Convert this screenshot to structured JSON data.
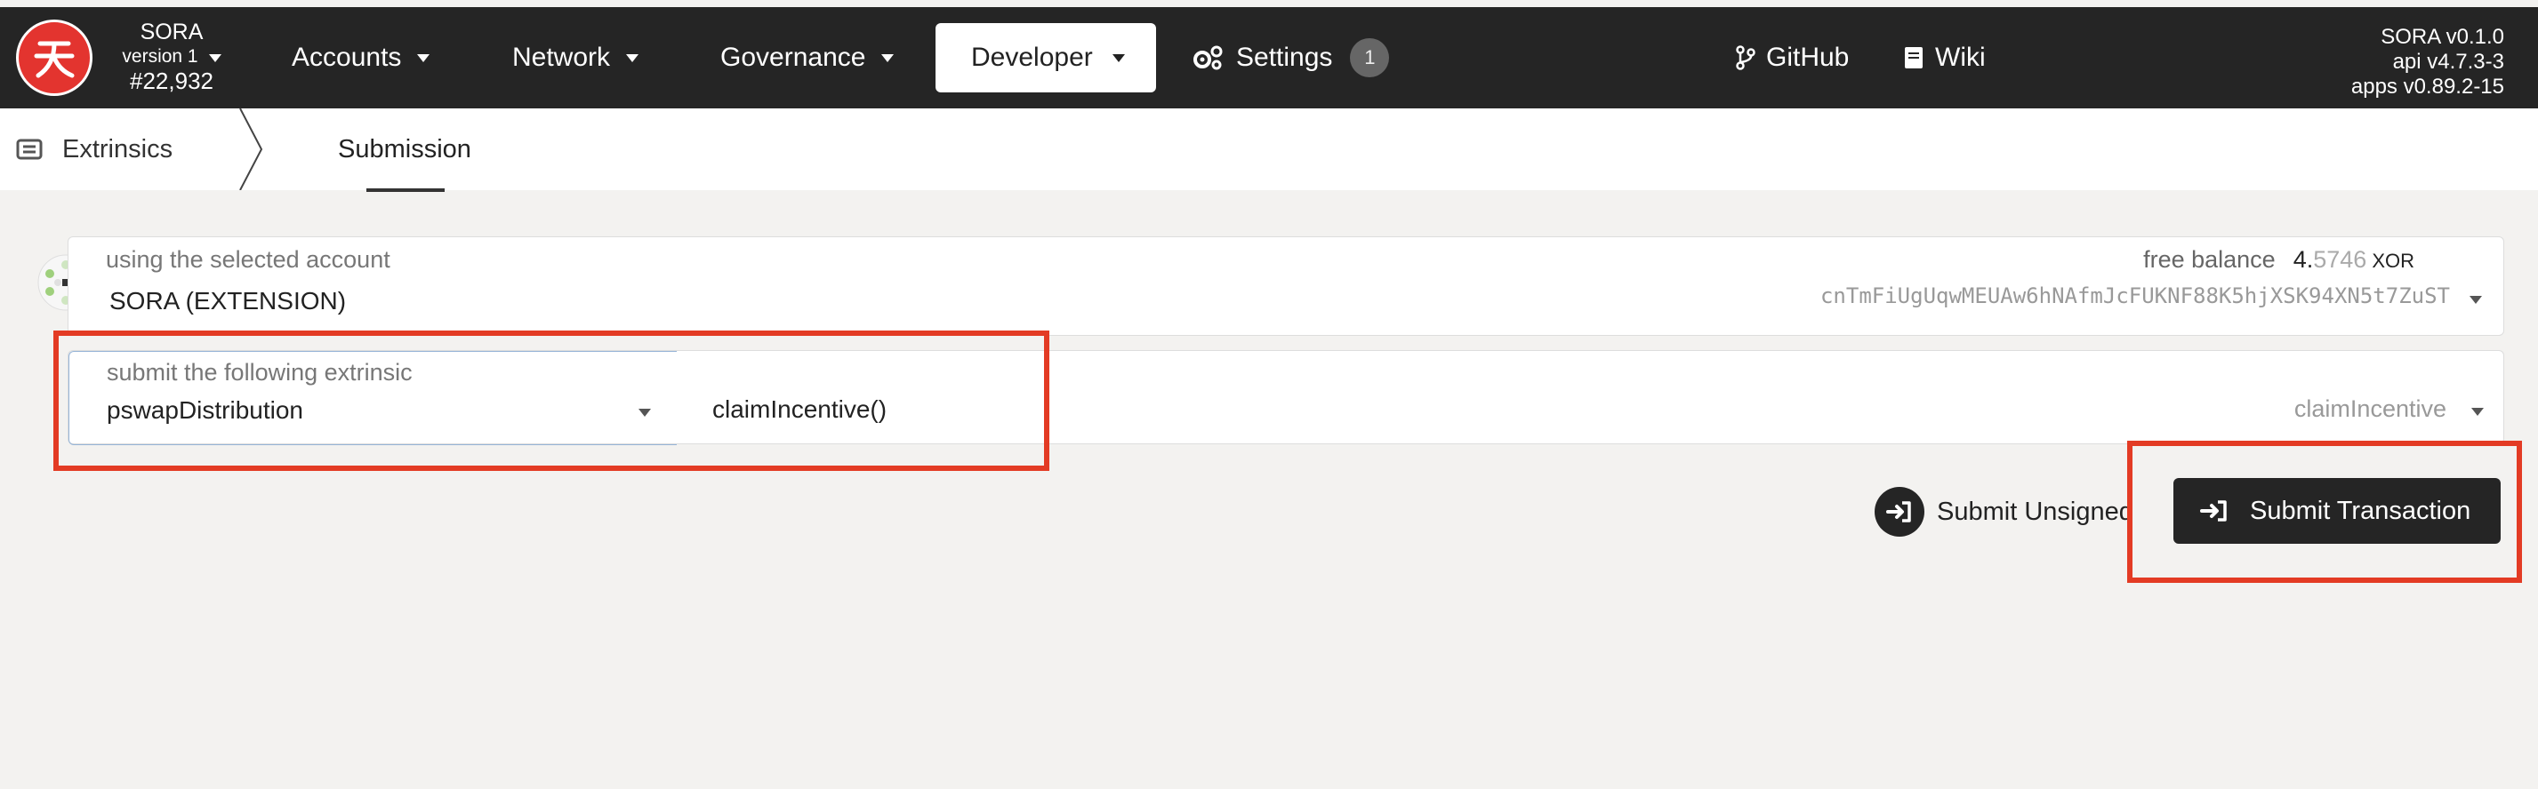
{
  "header": {
    "chain_name": "SORA",
    "chain_version": "version 1",
    "block_number": "#22,932",
    "nav": {
      "accounts": "Accounts",
      "network": "Network",
      "governance": "Governance",
      "developer": "Developer",
      "settings": "Settings",
      "settings_badge": "1",
      "github": "GitHub",
      "wiki": "Wiki"
    },
    "versions": {
      "node": "SORA v0.1.0",
      "api": "api v4.7.3-3",
      "apps": "apps v0.89.2-15"
    }
  },
  "subnav": {
    "section": "Extrinsics",
    "tab": "Submission"
  },
  "account": {
    "label": "using the selected account",
    "name": "SORA (EXTENSION)",
    "balance_label": "free balance",
    "balance_int": "4.",
    "balance_dec": "5746",
    "balance_unit": "XOR",
    "address": "cnTmFiUgUqwMEUAw6hNAfmJcFUKNF88K5hjXSK94XN5t7ZuST"
  },
  "extrinsic": {
    "label": "submit the following extrinsic",
    "section": "pswapDistribution",
    "method": "claimIncentive()",
    "method_dropdown": "claimIncentive"
  },
  "actions": {
    "submit_unsigned": "Submit Unsigned",
    "submit_transaction": "Submit Transaction"
  },
  "colors": {
    "topbar": "#252525",
    "logo": "#e3342f",
    "highlight": "#e33b24"
  }
}
